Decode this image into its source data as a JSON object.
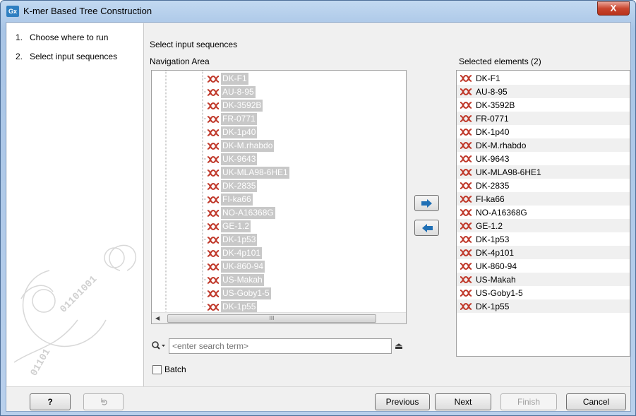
{
  "window": {
    "title": "K-mer Based Tree Construction",
    "app_icon_text": "Gx",
    "close_label": "X"
  },
  "steps": [
    {
      "num": "1.",
      "label": "Choose where to run"
    },
    {
      "num": "2.",
      "label": "Select input sequences"
    }
  ],
  "main": {
    "section_title": "Select input sequences",
    "nav_label": "Navigation Area",
    "selected_label": "Selected elements (2)"
  },
  "navigation_items": [
    "DK-F1",
    "AU-8-95",
    "DK-3592B",
    "FR-0771",
    "DK-1p40",
    "DK-M.rhabdo",
    "UK-9643",
    "UK-MLA98-6HE1",
    "DK-2835",
    "FI-ka66",
    "NO-A16368G",
    "GE-1.2",
    "DK-1p53",
    "DK-4p101",
    "UK-860-94",
    "US-Makah",
    "US-Goby1-5",
    "DK-1p55"
  ],
  "selected_items": [
    "DK-F1",
    "AU-8-95",
    "DK-3592B",
    "FR-0771",
    "DK-1p40",
    "DK-M.rhabdo",
    "UK-9643",
    "UK-MLA98-6HE1",
    "DK-2835",
    "FI-ka66",
    "NO-A16368G",
    "GE-1.2",
    "DK-1p53",
    "DK-4p101",
    "UK-860-94",
    "US-Makah",
    "US-Goby1-5",
    "DK-1p55"
  ],
  "search": {
    "placeholder": "<enter search term>",
    "value": ""
  },
  "batch": {
    "label": "Batch",
    "checked": false
  },
  "buttons": {
    "help": "?",
    "previous": "Previous",
    "next": "Next",
    "finish": "Finish",
    "cancel": "Cancel"
  },
  "scrollbar": {
    "hscroll_grip": "III"
  },
  "colors": {
    "sequence_icon": "#c0392b",
    "move_arrow": "#1f6fb5",
    "selection_highlight": "#c8c8c8"
  }
}
